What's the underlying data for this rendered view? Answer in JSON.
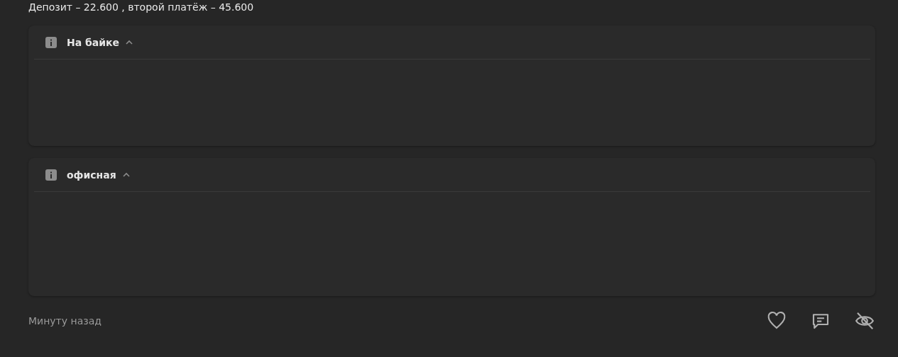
{
  "note": "Депозит – 22.600 , второй платёж – 45.600",
  "sections": [
    {
      "title": "На байке",
      "expanded": true
    },
    {
      "title": "офисная",
      "expanded": true
    }
  ],
  "footer": {
    "time": "Минуту назад"
  }
}
